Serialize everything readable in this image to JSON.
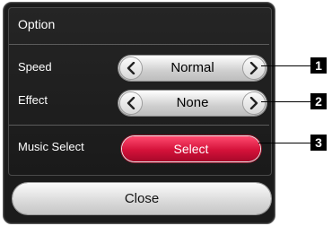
{
  "dialog": {
    "title": "Option",
    "speed": {
      "label": "Speed",
      "value": "Normal"
    },
    "effect": {
      "label": "Effect",
      "value": "None"
    },
    "music_select": {
      "label": "Music Select",
      "button_label": "Select"
    },
    "close_label": "Close"
  },
  "callouts": [
    "1",
    "2",
    "3"
  ],
  "colors": {
    "panel_bg": "#1b1b1b",
    "select_button": "#d4123a",
    "selector_bg": "#ffffff",
    "callout_bg": "#000000"
  },
  "icons": {
    "prev": "chevron-left-icon",
    "next": "chevron-right-icon"
  }
}
